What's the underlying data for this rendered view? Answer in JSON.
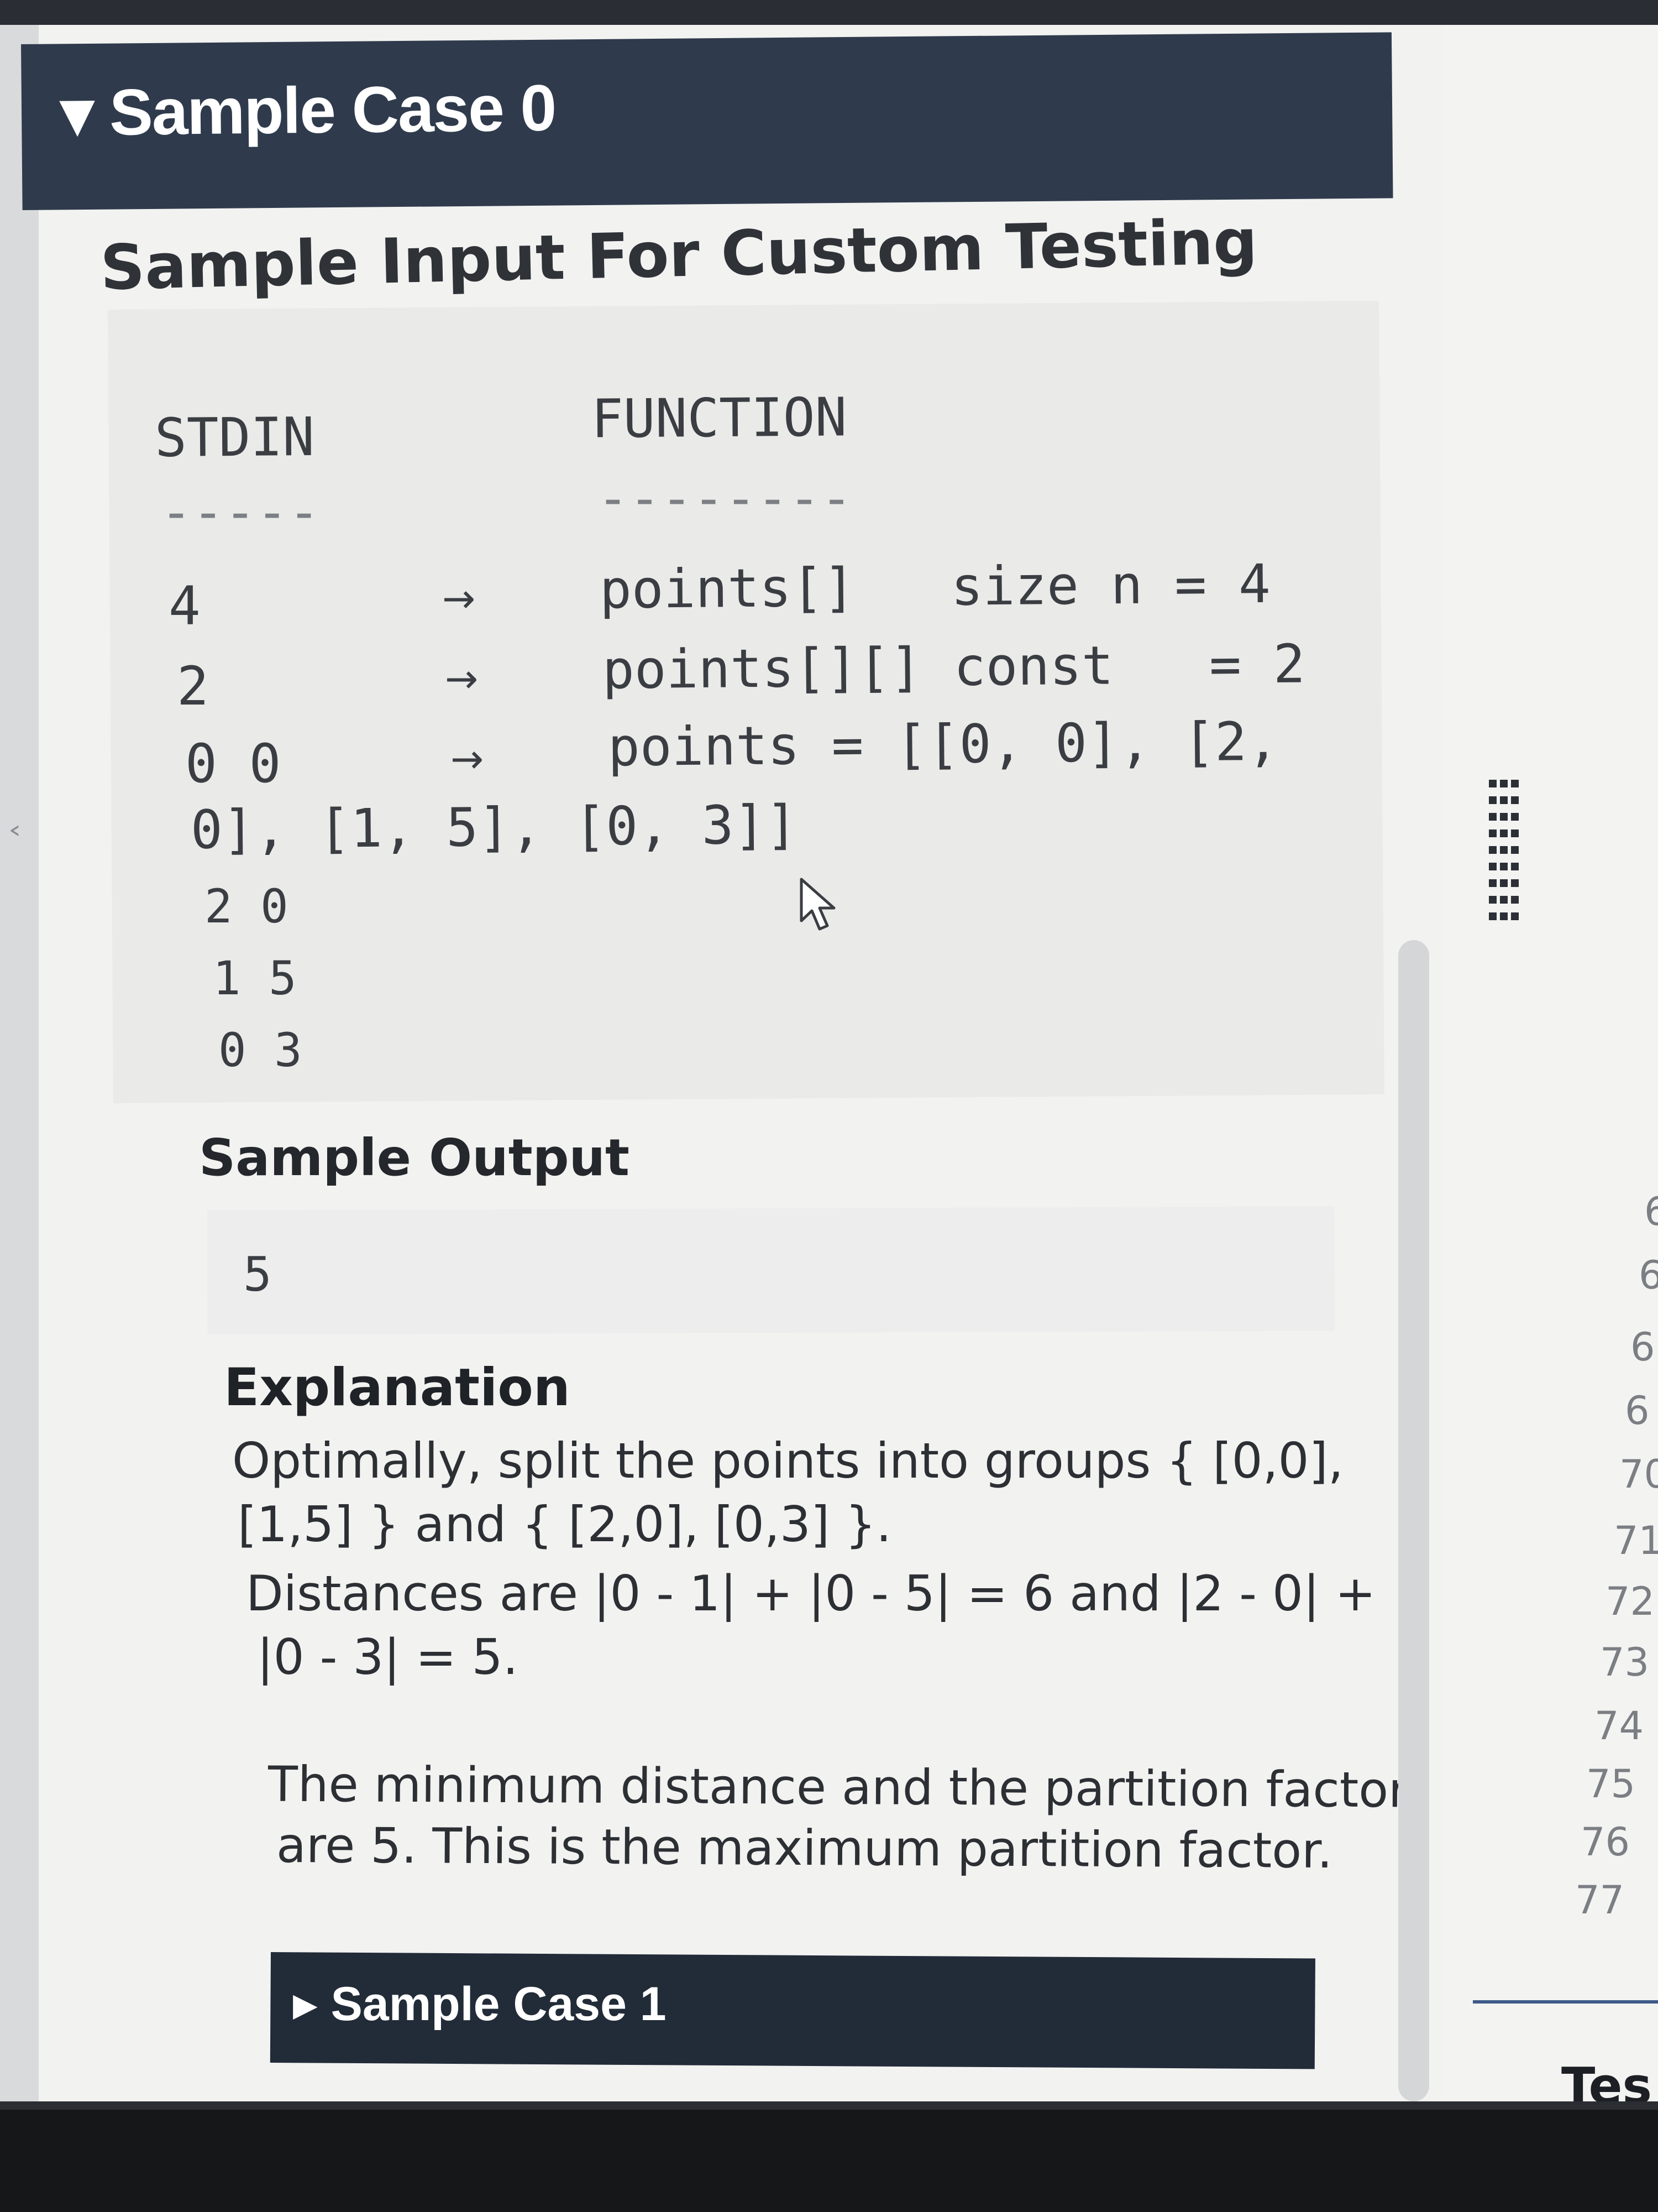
{
  "sample_case_0": {
    "arrow": "▾",
    "title": "Sample Case 0"
  },
  "custom_input": {
    "heading": "Sample Input For Custom Testing",
    "columns": {
      "stdin": "STDIN",
      "stdin_rule": "-----",
      "function": "FUNCTION",
      "function_rule": "--------"
    },
    "rows": [
      {
        "stdin": "4",
        "arrow": "→",
        "function": "points[]   size n = 4"
      },
      {
        "stdin": "2",
        "arrow": "→",
        "function": "points[][] const   = 2"
      },
      {
        "stdin": "0 0",
        "arrow": "→",
        "function": "points = [[0, 0], [2,"
      }
    ],
    "wrap_line": "0], [1, 5], [0, 3]]",
    "extra_lines": [
      "2 0",
      "1 5",
      "0 3"
    ]
  },
  "sample_output": {
    "heading": "Sample Output",
    "value": "5"
  },
  "explanation": {
    "heading": "Explanation",
    "lines": [
      "Optimally, split the points into groups { [0,0],",
      "[1,5] } and { [2,0], [0,3] }.",
      "Distances are |0 - 1| + |0 - 5| = 6 and |2 - 0| +",
      "|0 - 3| = 5.",
      "The minimum distance and the partition factor",
      "are 5. This is the maximum partition factor."
    ]
  },
  "sample_case_1": {
    "arrow": "▶",
    "title": "Sample Case 1"
  },
  "right_panel": {
    "line_numbers": [
      "6",
      "6",
      "6",
      "6",
      "70",
      "71",
      "72",
      "73",
      "74",
      "75",
      "76",
      "77"
    ],
    "tab_label": "Tes"
  },
  "left_strip": {
    "chevron": "‹"
  }
}
